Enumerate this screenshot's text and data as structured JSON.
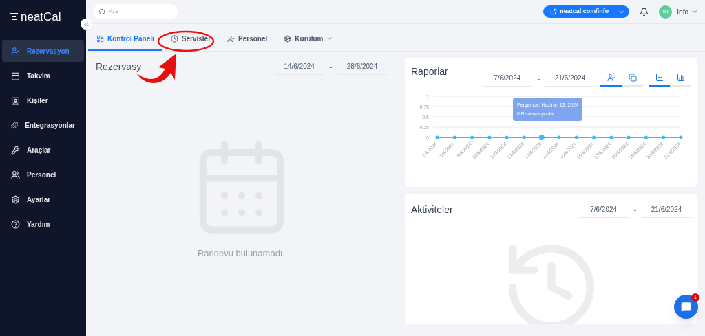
{
  "sidebar": {
    "logo": "neatCal",
    "items": [
      {
        "label": "Rezervasyon",
        "selected": true
      },
      {
        "label": "Takvim",
        "selected": false
      },
      {
        "label": "Kişiler",
        "selected": false
      },
      {
        "label": "Entegrasyonlar",
        "selected": false
      },
      {
        "label": "Araçlar",
        "selected": false
      },
      {
        "label": "Personel",
        "selected": false
      },
      {
        "label": "Ayarlar",
        "selected": false
      },
      {
        "label": "Yardım",
        "selected": false
      }
    ]
  },
  "topbar": {
    "search": {
      "placeholder": "Ara"
    },
    "link_button": "neatcal.com/info",
    "avatar": "IN",
    "user": "Info"
  },
  "tabs": [
    {
      "label": "Kontrol Paneli",
      "selected": true,
      "dropdown": false
    },
    {
      "label": "Servisler",
      "selected": false,
      "dropdown": false
    },
    {
      "label": "Personel",
      "selected": false,
      "dropdown": false
    },
    {
      "label": "Kurulum",
      "selected": false,
      "dropdown": true
    }
  ],
  "reservations": {
    "title": "Rezervasy",
    "date_from": "14/6/2024",
    "separator": "-",
    "date_to": "28/6/2024",
    "empty_text": "Randevu bulunamadı."
  },
  "reports": {
    "title": "Raporlar",
    "date_from": "7/6/2024",
    "separator": "-",
    "date_to": "21/6/2024",
    "mode_toggles": [
      {
        "selected": true
      },
      {
        "selected": false
      }
    ],
    "chart_toggles": [
      {
        "selected": true
      },
      {
        "selected": false
      }
    ],
    "tooltip": {
      "title": "Perşembe, Haziran 13, 2024",
      "body": "0 Rezervasyonlar"
    },
    "chart_data": {
      "type": "line",
      "grid": true,
      "categories": [
        "7/6/2024",
        "8/6/2024",
        "9/6/2024",
        "10/6/2024",
        "11/6/2024",
        "12/6/2024",
        "13/6/2024",
        "14/6/2024",
        "15/6/2024",
        "16/6/2024",
        "17/6/2024",
        "18/6/2024",
        "19/6/2024",
        "20/6/2024",
        "21/6/2024"
      ],
      "series": [
        {
          "color": "#38bdf8",
          "values": [
            0,
            0,
            0,
            0,
            0,
            0,
            0,
            0,
            0,
            0,
            0,
            0,
            0,
            0,
            0
          ]
        }
      ],
      "ylim": [
        0,
        1
      ],
      "yticks": [
        0,
        0.25,
        0.5,
        0.75,
        1
      ]
    }
  },
  "activities": {
    "title": "Aktiviteler",
    "date_from": "7/6/2024",
    "separator": "-",
    "date_to": "21/6/2024"
  },
  "chat": {
    "badge": "1"
  }
}
